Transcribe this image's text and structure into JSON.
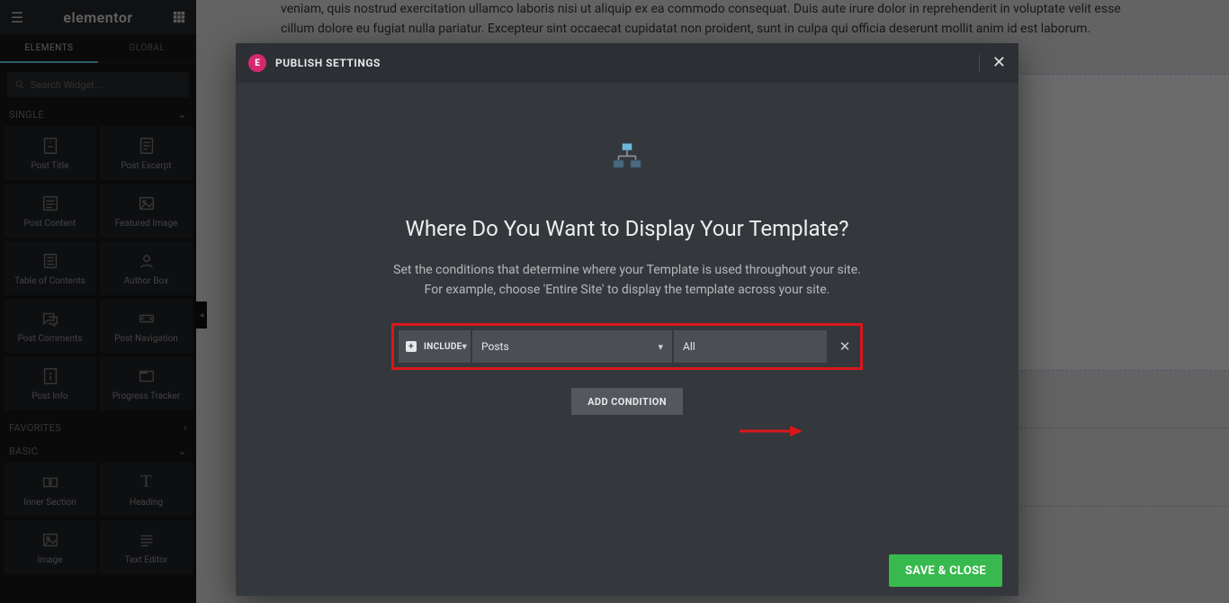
{
  "sidebar": {
    "brand": "elementor",
    "tabs": {
      "elements": "ELEMENTS",
      "global": "GLOBAL"
    },
    "search_placeholder": "Search Widget...",
    "section_single": "SINGLE",
    "widgets_single": [
      {
        "label": "Post Title"
      },
      {
        "label": "Post Excerpt"
      },
      {
        "label": "Post Content"
      },
      {
        "label": "Featured Image"
      },
      {
        "label": "Table of Contents"
      },
      {
        "label": "Author Box"
      },
      {
        "label": "Post Comments"
      },
      {
        "label": "Post Navigation"
      },
      {
        "label": "Post Info"
      },
      {
        "label": "Progress Tracker"
      }
    ],
    "section_favorites": "FAVORITES",
    "section_basic": "BASIC",
    "widgets_basic": [
      {
        "label": "Inner Section"
      },
      {
        "label": "Heading"
      },
      {
        "label": "Image"
      },
      {
        "label": "Text Editor"
      }
    ]
  },
  "canvas": {
    "lorem": "veniam, quis nostrud exercitation ullamco laboris nisi ut aliquip ex ea commodo consequat. Duis aute irure dolor in reprehenderit in voluptate velit esse cillum dolore eu fugiat nulla pariatur. Excepteur sint occaecat cupidatat non proident, sunt in culpa qui officia deserunt mollit anim id est laborum."
  },
  "modal": {
    "title": "PUBLISH SETTINGS",
    "heading": "Where Do You Want to Display Your Template?",
    "sub1": "Set the conditions that determine where your Template is used throughout your site.",
    "sub2": "For example, choose 'Entire Site' to display the template across your site.",
    "condition": {
      "mode": "INCLUDE",
      "type": "Posts",
      "scope": "All"
    },
    "add_label": "ADD CONDITION",
    "save_label": "SAVE & CLOSE"
  }
}
